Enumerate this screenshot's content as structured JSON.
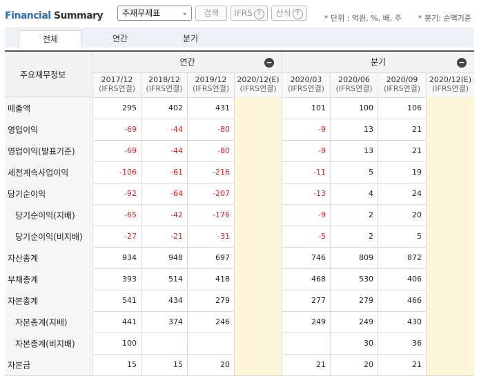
{
  "header": {
    "title_prefix": "Financial",
    "title_suffix": "Summary",
    "select_value": "주재무제표",
    "select_arrow": "⌄",
    "search_label": "검색",
    "ifrs_label": "IFRS",
    "formula_label": "산식",
    "help_glyph": "?",
    "unit_note": "* 단위 : 억원, %, 배, 주",
    "quarter_note": "* 분기: 순액기준"
  },
  "tabs": [
    {
      "label": "전체",
      "active": true
    },
    {
      "label": "연간",
      "active": false
    },
    {
      "label": "분기",
      "active": false
    }
  ],
  "table": {
    "corner_label": "주요재무정보",
    "group_annual": "연간",
    "group_quarter": "분기",
    "collapse_glyph": "−",
    "periods": [
      {
        "date": "2017/12",
        "basis": "(IFRS연결)"
      },
      {
        "date": "2018/12",
        "basis": "(IFRS연결)"
      },
      {
        "date": "2019/12",
        "basis": "(IFRS연결)"
      },
      {
        "date": "2020/12(E)",
        "basis": "(IFRS연결)"
      },
      {
        "date": "2020/03",
        "basis": "(IFRS연결)"
      },
      {
        "date": "2020/06",
        "basis": "(IFRS연결)"
      },
      {
        "date": "2020/09",
        "basis": "(IFRS연결)"
      },
      {
        "date": "2020/12(E)",
        "basis": "(IFRS연결)"
      }
    ],
    "rows": [
      {
        "label": "매출액",
        "indent": false,
        "values": [
          "295",
          "402",
          "431",
          "",
          "101",
          "100",
          "106",
          ""
        ]
      },
      {
        "label": "영업이익",
        "indent": false,
        "values": [
          "-69",
          "-44",
          "-80",
          "",
          "-9",
          "13",
          "21",
          ""
        ]
      },
      {
        "label": "영업이익(발표기준)",
        "indent": false,
        "values": [
          "-69",
          "-44",
          "-80",
          "",
          "-9",
          "13",
          "21",
          ""
        ]
      },
      {
        "label": "세전계속사업이익",
        "indent": false,
        "values": [
          "-106",
          "-61",
          "-216",
          "",
          "-11",
          "5",
          "19",
          ""
        ]
      },
      {
        "label": "당기순이익",
        "indent": false,
        "values": [
          "-92",
          "-64",
          "-207",
          "",
          "-13",
          "4",
          "24",
          ""
        ]
      },
      {
        "label": "당기순이익(지배)",
        "indent": true,
        "values": [
          "-65",
          "-42",
          "-176",
          "",
          "-9",
          "2",
          "20",
          ""
        ]
      },
      {
        "label": "당기순이익(비지배)",
        "indent": true,
        "values": [
          "-27",
          "-21",
          "-31",
          "",
          "-5",
          "2",
          "5",
          ""
        ]
      },
      {
        "label": "자산총계",
        "indent": false,
        "values": [
          "934",
          "948",
          "697",
          "",
          "746",
          "809",
          "872",
          ""
        ]
      },
      {
        "label": "부채총계",
        "indent": false,
        "values": [
          "393",
          "514",
          "418",
          "",
          "468",
          "530",
          "406",
          ""
        ]
      },
      {
        "label": "자본총계",
        "indent": false,
        "values": [
          "541",
          "434",
          "279",
          "",
          "277",
          "279",
          "466",
          ""
        ]
      },
      {
        "label": "자본총계(지배)",
        "indent": true,
        "values": [
          "441",
          "374",
          "246",
          "",
          "249",
          "249",
          "430",
          ""
        ]
      },
      {
        "label": "자본총계(비지배)",
        "indent": true,
        "values": [
          "100",
          "",
          "",
          "",
          "",
          "30",
          "36",
          ""
        ]
      },
      {
        "label": "자본금",
        "indent": false,
        "values": [
          "15",
          "15",
          "20",
          "",
          "21",
          "20",
          "21",
          ""
        ]
      }
    ]
  },
  "colors": {
    "negative": "#dd2222",
    "estimate_bg": "#fdf7d9",
    "title_blue": "#2f6db5"
  }
}
